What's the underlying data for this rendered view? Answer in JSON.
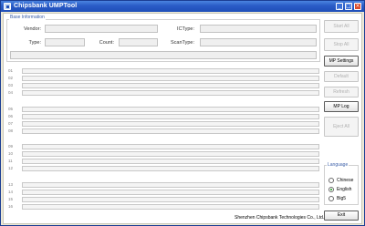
{
  "window": {
    "title": "Chipsbank UMPTool",
    "minimize": "_",
    "maximize": "□",
    "close": "×"
  },
  "base_info": {
    "group_label": "Base Information",
    "vendor_label": "Vendor:",
    "ictype_label": "ICType:",
    "type_label": "Type:",
    "count_label": "Count:",
    "scantype_label": "ScanType:"
  },
  "ports": [
    "01",
    "02",
    "03",
    "04",
    "05",
    "06",
    "07",
    "08",
    "09",
    "10",
    "11",
    "12",
    "13",
    "14",
    "15",
    "16"
  ],
  "buttons": {
    "start_all": "Start All",
    "stop_all": "Stop All",
    "mp_settings": "MP Settings",
    "default": "Default",
    "refresh": "Refresh",
    "mp_log": "MP Log",
    "eject_all": "Eject All",
    "exit": "Exit"
  },
  "language": {
    "title": "Language",
    "options": [
      "Chinese",
      "English",
      "Big5"
    ],
    "selected": "English"
  },
  "footer": {
    "company": "Shenzhen Chipsbank Technologies Co., Ltd."
  },
  "colors": {
    "titlebar": "#1f4fb8",
    "group_label": "#3a5ea8",
    "client_bg": "#ffffff"
  }
}
